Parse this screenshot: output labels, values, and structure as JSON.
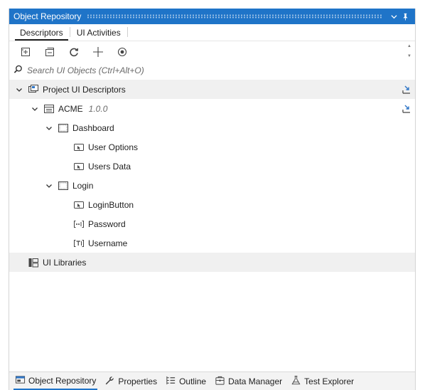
{
  "window": {
    "title": "Object Repository",
    "dropdown_icon": "chevron-down-icon",
    "pin_icon": "pin-icon"
  },
  "tabs": [
    {
      "label": "Descriptors",
      "active": true
    },
    {
      "label": "UI Activities",
      "active": false
    }
  ],
  "toolbar": {
    "items": [
      "add-screen-icon",
      "add-element-icon",
      "refresh-icon",
      "crosshair-icon",
      "target-icon"
    ]
  },
  "search": {
    "placeholder": "Search UI Objects (Ctrl+Alt+O)"
  },
  "tree": {
    "project": {
      "label": "Project UI Descriptors"
    },
    "app": {
      "label": "ACME",
      "version": "1.0.0"
    },
    "screens": [
      {
        "label": "Dashboard",
        "elements": [
          {
            "label": "User Options",
            "type": "click"
          },
          {
            "label": "Users Data",
            "type": "click"
          }
        ]
      },
      {
        "label": "Login",
        "elements": [
          {
            "label": "LoginButton",
            "type": "click"
          },
          {
            "label": "Password",
            "type": "password"
          },
          {
            "label": "Username",
            "type": "text"
          }
        ]
      }
    ],
    "libraries": {
      "label": "UI Libraries"
    }
  },
  "bottom_tabs": [
    {
      "label": "Object Repository",
      "active": true
    },
    {
      "label": "Properties",
      "active": false
    },
    {
      "label": "Outline",
      "active": false
    },
    {
      "label": "Data Manager",
      "active": false
    },
    {
      "label": "Test Explorer",
      "active": false
    }
  ],
  "colors": {
    "titlebar": "#1f74c8",
    "icon_blue": "#2e75c6",
    "text": "#1e1e1e",
    "selected_row": "#f0f0f0"
  }
}
